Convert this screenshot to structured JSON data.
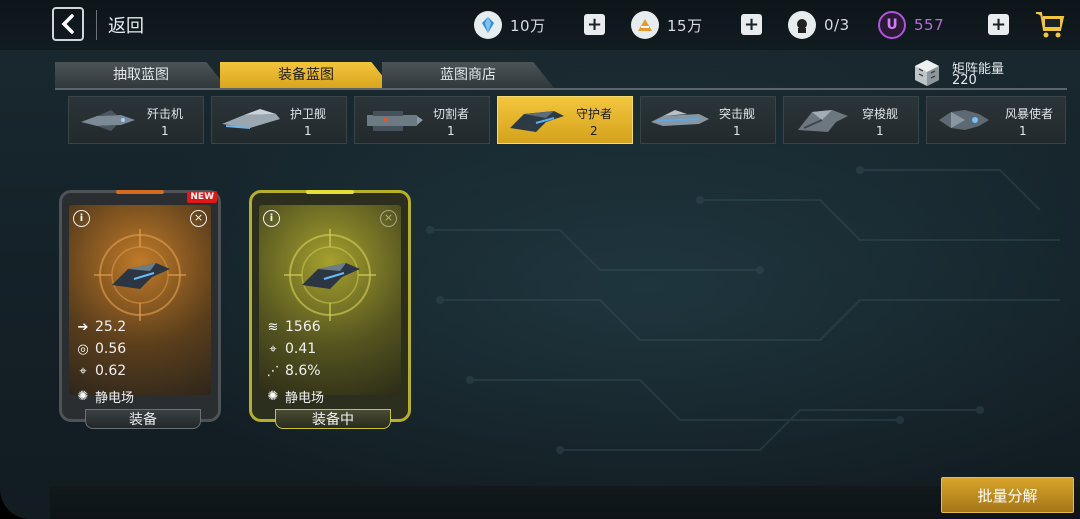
{
  "header": {
    "back_label": "返回",
    "resources": [
      {
        "name": "crystal",
        "icon": "crystal-icon",
        "value": "10万",
        "color": "#2f8fd8"
      },
      {
        "name": "metal",
        "icon": "metal-icon",
        "value": "15万",
        "color": "#e79a28"
      },
      {
        "name": "pilots",
        "icon": "pilot-icon",
        "value": "0/3",
        "color": "#cfd6da"
      },
      {
        "name": "currency",
        "icon": "u-coin-icon",
        "icon_text": "U",
        "value": "557",
        "color": "#b054d8"
      }
    ],
    "plus_label": "+"
  },
  "tabs": [
    {
      "label": "抽取蓝图",
      "active": false
    },
    {
      "label": "装备蓝图",
      "active": true
    },
    {
      "label": "蓝图商店",
      "active": false
    }
  ],
  "matrix": {
    "label": "矩阵能量",
    "value": "220"
  },
  "categories": [
    {
      "name": "歼击机",
      "count": "1",
      "active": false
    },
    {
      "name": "护卫舰",
      "count": "1",
      "active": false
    },
    {
      "name": "切割者",
      "count": "1",
      "active": false
    },
    {
      "name": "守护者",
      "count": "2",
      "active": true
    },
    {
      "name": "突击舰",
      "count": "1",
      "active": false
    },
    {
      "name": "穿梭舰",
      "count": "1",
      "active": false
    },
    {
      "name": "风暴使者",
      "count": "1",
      "active": false
    }
  ],
  "cards": [
    {
      "badge": "NEW",
      "stats": [
        {
          "icon": "arrow-icon",
          "value": "25.2"
        },
        {
          "icon": "speed-icon",
          "value": "0.56"
        },
        {
          "icon": "crosshair-icon",
          "value": "0.62"
        },
        {
          "icon": "static-field-icon",
          "value": "静电场"
        }
      ],
      "button": "装备",
      "equipped": false
    },
    {
      "badge": "",
      "stats": [
        {
          "icon": "armor-icon",
          "value": "1566"
        },
        {
          "icon": "crosshair-icon",
          "value": "0.41"
        },
        {
          "icon": "spread-icon",
          "value": "8.6%"
        },
        {
          "icon": "static-field-icon",
          "value": "静电场"
        }
      ],
      "button": "装备中",
      "equipped": true
    }
  ],
  "batch_button": "批量分解",
  "colors": {
    "accent": "#f2c63c",
    "panel": "#222a2d",
    "equipped_border": "#b6b027"
  }
}
